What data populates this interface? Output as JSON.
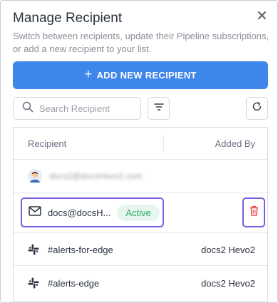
{
  "dialog": {
    "title": "Manage Recipient",
    "subtitle": "Switch between recipients, update their Pipeline subscriptions, or add a new recipient to your list.",
    "close_icon": "close-icon"
  },
  "actions": {
    "add_label": "ADD NEW RECIPIENT",
    "add_icon": "plus-icon",
    "button_color": "#3e86ea"
  },
  "search": {
    "placeholder": "Search Recipient",
    "value": ""
  },
  "table": {
    "columns": [
      "Recipient",
      "Added By"
    ],
    "rows": [
      {
        "type": "user",
        "recipient": "docs2@docsHevo2.com",
        "added_by": "",
        "icon": "avatar"
      },
      {
        "type": "email",
        "recipient": "docs@docsH...",
        "status": "Active",
        "added_by": "",
        "icon": "mail-icon",
        "action_icon": "trash-icon"
      },
      {
        "type": "slack",
        "recipient": "#alerts-for-edge",
        "added_by": "docs2 Hevo2",
        "icon": "slack-icon"
      },
      {
        "type": "slack",
        "recipient": "#alerts-edge",
        "added_by": "docs2 Hevo2",
        "icon": "slack-icon"
      }
    ]
  },
  "colors": {
    "highlight": "#7c5ce0",
    "active_badge": "#2fab6b",
    "delete": "#e5484d"
  }
}
